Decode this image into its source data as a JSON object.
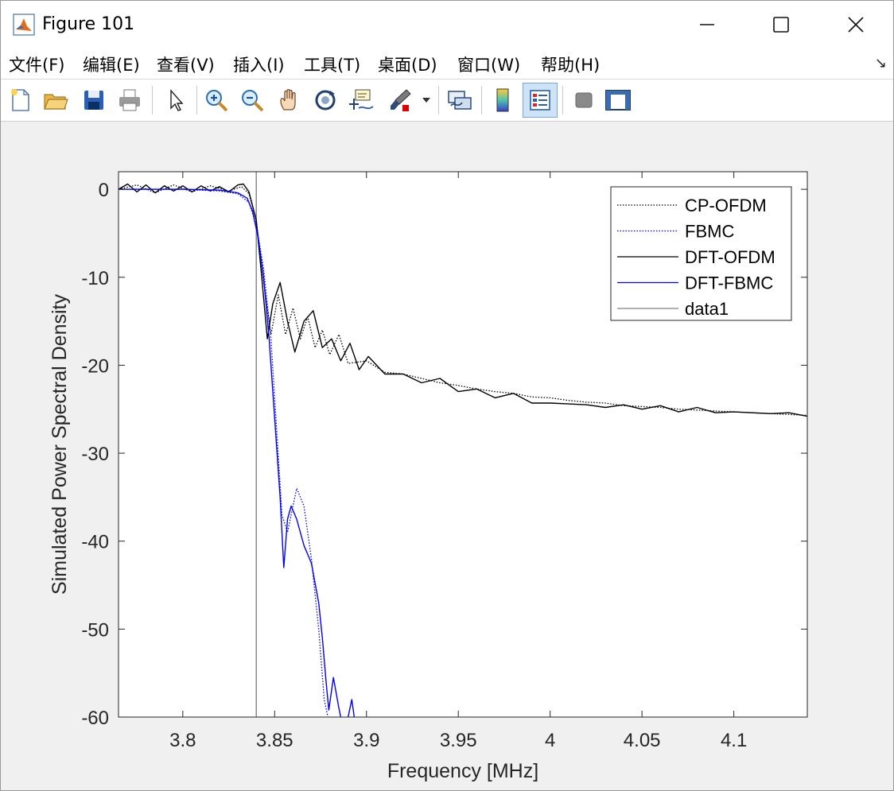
{
  "window": {
    "title": "Figure 101"
  },
  "menu": [
    "文件(F)",
    "编辑(E)",
    "查看(V)",
    "插入(I)",
    "工具(T)",
    "桌面(D)",
    "窗口(W)",
    "帮助(H)"
  ],
  "toolbar": [
    "new-figure-icon",
    "open-file-icon",
    "save-icon",
    "print-icon",
    "pointer-icon",
    "zoom-in-icon",
    "zoom-out-icon",
    "pan-hand-icon",
    "rotate-3d-icon",
    "data-cursor-icon",
    "brush-icon",
    "link-plot-icon",
    "colorbar-icon",
    "legend-icon",
    "hide-plot-tools-icon",
    "show-plot-tools-icon"
  ],
  "chart_data": {
    "type": "line",
    "xlabel": "Frequency [MHz]",
    "ylabel": "Simulated Power Spectral Density",
    "xlim": [
      3.765,
      4.14
    ],
    "ylim": [
      -60,
      2
    ],
    "xticks": [
      3.8,
      3.85,
      3.9,
      3.95,
      4,
      4.05,
      4.1
    ],
    "xtick_labels": [
      "3.8",
      "3.85",
      "3.9",
      "3.95",
      "4",
      "4.05",
      "4.1"
    ],
    "yticks": [
      0,
      -10,
      -20,
      -30,
      -40,
      -50,
      -60
    ],
    "ytick_labels": [
      "0",
      "-10",
      "-20",
      "-30",
      "-40",
      "-50",
      "-60"
    ],
    "grid": false,
    "legend_position": "top-right",
    "series": [
      {
        "name": "CP-OFDM",
        "color": "#000000",
        "style": "dotted",
        "x": [
          3.765,
          3.775,
          3.785,
          3.795,
          3.805,
          3.815,
          3.825,
          3.832,
          3.836,
          3.84,
          3.844,
          3.848,
          3.852,
          3.856,
          3.86,
          3.864,
          3.868,
          3.872,
          3.876,
          3.88,
          3.885,
          3.89,
          3.9,
          3.91,
          3.92,
          3.93,
          3.94,
          3.95,
          3.96,
          3.97,
          3.98,
          3.99,
          4.0,
          4.01,
          4.02,
          4.03,
          4.04,
          4.05,
          4.06,
          4.07,
          4.08,
          4.09,
          4.1,
          4.11,
          4.12,
          4.13,
          4.14
        ],
        "y": [
          0,
          0.5,
          -0.4,
          0.5,
          -0.3,
          0.4,
          -0.2,
          0.3,
          -0.5,
          -3.5,
          -10.5,
          -16.5,
          -12,
          -16.5,
          -13.5,
          -17,
          -14.5,
          -18,
          -16,
          -18.8,
          -16.5,
          -19.8,
          -19.5,
          -20.8,
          -21,
          -21.5,
          -22,
          -22.3,
          -22.7,
          -23,
          -23.2,
          -23.6,
          -23.7,
          -24,
          -24.2,
          -24.3,
          -24.6,
          -24.7,
          -24.8,
          -25,
          -25.1,
          -25.2,
          -25.3,
          -25.4,
          -25.5,
          -25.6,
          -25.7
        ]
      },
      {
        "name": "FBMC",
        "color": "#0000ff",
        "style": "dotted",
        "x": [
          3.765,
          3.78,
          3.8,
          3.82,
          3.83,
          3.836,
          3.84,
          3.844,
          3.848,
          3.851,
          3.854,
          3.857,
          3.862,
          3.866,
          3.87,
          3.874,
          3.877,
          3.879,
          3.882,
          3.886,
          3.89,
          3.894
        ],
        "y": [
          0,
          0,
          0,
          -0.2,
          -0.5,
          -1.5,
          -4,
          -9,
          -17,
          -27,
          -37,
          -39,
          -34,
          -36,
          -42,
          -50,
          -58,
          -60,
          -61,
          -60.2,
          -62,
          -63
        ]
      },
      {
        "name": "DFT-OFDM",
        "color": "#000000",
        "style": "solid",
        "x": [
          3.765,
          3.77,
          3.775,
          3.78,
          3.785,
          3.79,
          3.795,
          3.8,
          3.805,
          3.81,
          3.815,
          3.82,
          3.825,
          3.83,
          3.833,
          3.836,
          3.84,
          3.843,
          3.846,
          3.849,
          3.853,
          3.857,
          3.861,
          3.866,
          3.871,
          3.876,
          3.881,
          3.886,
          3.891,
          3.896,
          3.901,
          3.91,
          3.92,
          3.93,
          3.94,
          3.95,
          3.96,
          3.97,
          3.98,
          3.99,
          4.0,
          4.01,
          4.02,
          4.03,
          4.04,
          4.05,
          4.06,
          4.07,
          4.08,
          4.09,
          4.1,
          4.11,
          4.12,
          4.13,
          4.14
        ],
        "y": [
          0,
          0.6,
          -0.3,
          0.5,
          -0.4,
          0.4,
          -0.2,
          0.4,
          -0.3,
          0.4,
          -0.2,
          0.3,
          -0.3,
          0.5,
          0.6,
          -0.3,
          -3.5,
          -10,
          -17,
          -13,
          -10.6,
          -15,
          -18.5,
          -15,
          -13.8,
          -18,
          -17,
          -19.5,
          -17.5,
          -20.5,
          -19,
          -21,
          -21,
          -22,
          -21.5,
          -23,
          -22.7,
          -23.7,
          -23.2,
          -24.3,
          -24.3,
          -24.4,
          -24.5,
          -24.8,
          -24.5,
          -25,
          -24.6,
          -25.3,
          -24.8,
          -25.4,
          -25.3,
          -25.4,
          -25.5,
          -25.4,
          -25.8
        ]
      },
      {
        "name": "DFT-FBMC",
        "color": "#0000ff",
        "style": "solid",
        "x": [
          3.765,
          3.78,
          3.8,
          3.82,
          3.83,
          3.835,
          3.838,
          3.841,
          3.844,
          3.847,
          3.85,
          3.853,
          3.855,
          3.857,
          3.859,
          3.862,
          3.866,
          3.87,
          3.874,
          3.876,
          3.878,
          3.8795,
          3.882,
          3.885,
          3.888,
          3.892,
          3.894
        ],
        "y": [
          0,
          0,
          0,
          -0.1,
          -0.4,
          -1,
          -2.5,
          -5.5,
          -10,
          -17,
          -26,
          -35,
          -43,
          -37.5,
          -36,
          -37.5,
          -40.5,
          -42.5,
          -47,
          -51,
          -56,
          -59.2,
          -55.5,
          -59,
          -62,
          -58,
          -61
        ]
      },
      {
        "name": "data1",
        "color": "#808080",
        "style": "solid",
        "x": [
          3.84,
          3.84
        ],
        "y": [
          2,
          -60
        ]
      }
    ]
  }
}
